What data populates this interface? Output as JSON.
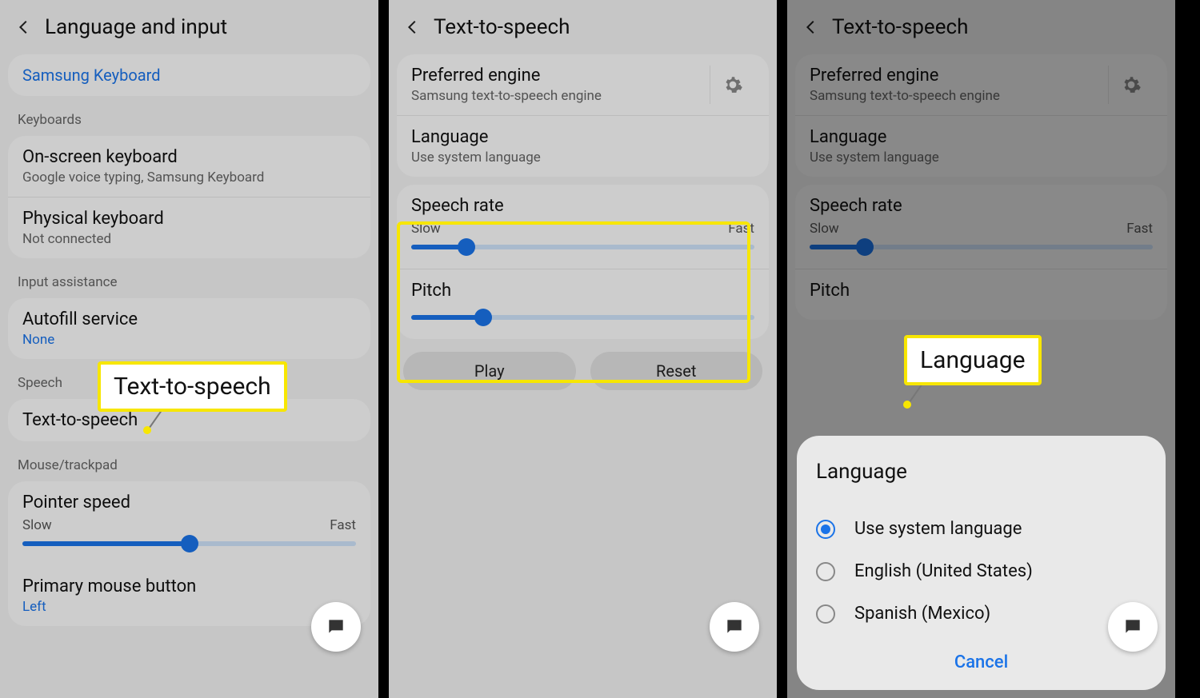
{
  "screen1": {
    "title": "Language and input",
    "samsung_keyboard": "Samsung Keyboard",
    "keyboards_label": "Keyboards",
    "onscreen_title": "On-screen keyboard",
    "onscreen_sub": "Google voice typing, Samsung Keyboard",
    "physical_title": "Physical keyboard",
    "physical_sub": "Not connected",
    "input_assist_label": "Input assistance",
    "autofill_title": "Autofill service",
    "autofill_sub": "None",
    "speech_label": "Speech",
    "tts_title": "Text-to-speech",
    "mouse_label": "Mouse/trackpad",
    "pointer_title": "Pointer speed",
    "pointer_slow": "Slow",
    "pointer_fast": "Fast",
    "pointer_value": 50,
    "primary_title": "Primary mouse button",
    "primary_sub": "Left",
    "callout_tts": "Text-to-speech"
  },
  "screen2": {
    "title": "Text-to-speech",
    "pref_engine_title": "Preferred engine",
    "pref_engine_sub": "Samsung text-to-speech engine",
    "language_title": "Language",
    "language_sub": "Use system language",
    "speech_rate": "Speech rate",
    "rate_slow": "Slow",
    "rate_fast": "Fast",
    "rate_value": 16,
    "pitch_title": "Pitch",
    "pitch_value": 21,
    "play": "Play",
    "reset": "Reset"
  },
  "screen3": {
    "title": "Text-to-speech",
    "pref_engine_title": "Preferred engine",
    "pref_engine_sub": "Samsung text-to-speech engine",
    "language_title": "Language",
    "language_sub": "Use system language",
    "speech_rate": "Speech rate",
    "rate_slow": "Slow",
    "rate_fast": "Fast",
    "rate_value": 16,
    "pitch_title": "Pitch",
    "dialog_title": "Language",
    "opt1": "Use system language",
    "opt2": "English (United States)",
    "opt3": "Spanish (Mexico)",
    "cancel": "Cancel",
    "callout_lang": "Language"
  }
}
